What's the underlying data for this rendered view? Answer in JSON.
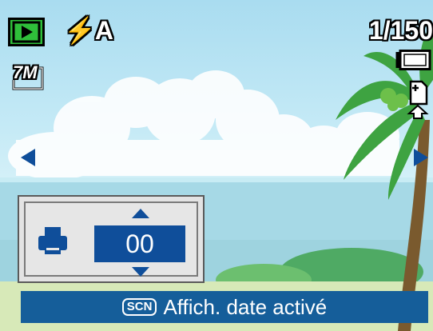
{
  "status": {
    "flash_mode": "⚡A",
    "shot_counter": "1/150",
    "resolution": "7M",
    "scene_badge": "SCN",
    "message": "Affich. date activé"
  },
  "print_dialog": {
    "quantity": "00"
  },
  "icons": {
    "play": "playback-mode-icon",
    "battery": "battery-icon",
    "print_transfer": "print-transfer-icon",
    "printer": "printer-icon",
    "nav_left": "arrow-left-icon",
    "nav_right": "arrow-right-icon",
    "qty_up": "triangle-up-icon",
    "qty_down": "triangle-down-icon"
  },
  "colors": {
    "accent_blue": "#0f4e9a",
    "status_bar": "#155e9a",
    "play_green": "#2fbf3a"
  }
}
